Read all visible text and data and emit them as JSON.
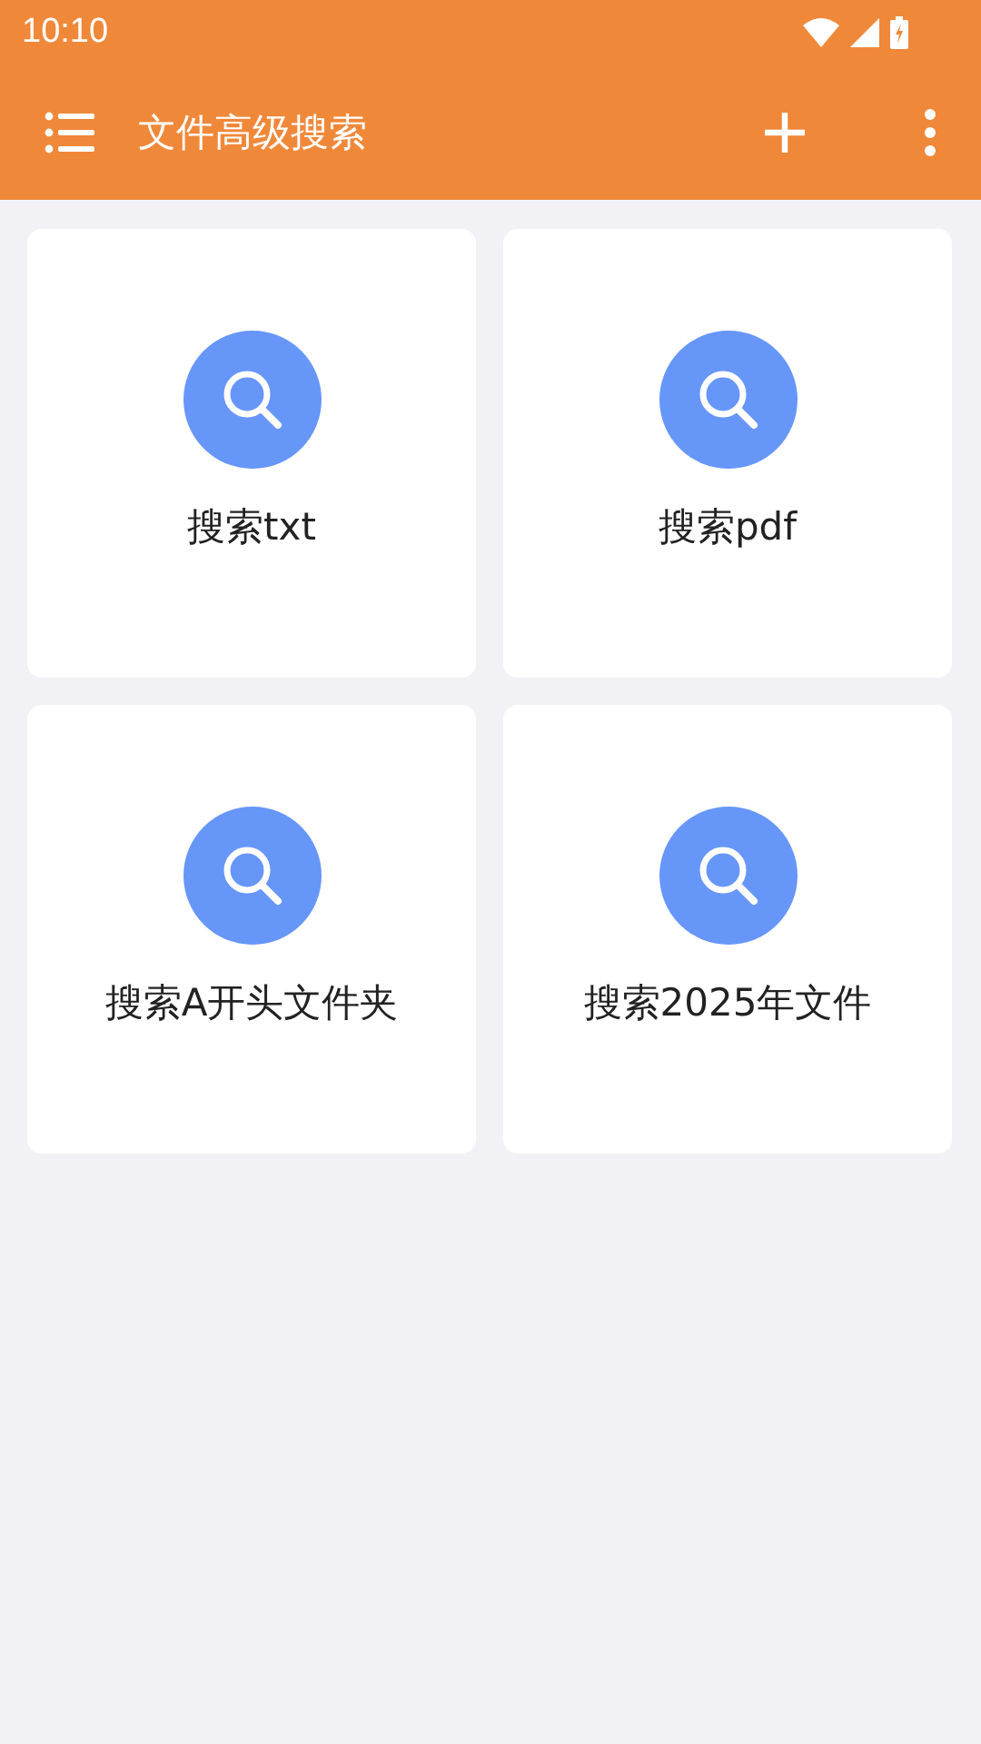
{
  "status_bar": {
    "time": "10:10"
  },
  "app_bar": {
    "title": "文件高级搜索"
  },
  "cards": [
    {
      "label": "搜索txt"
    },
    {
      "label": "搜索pdf"
    },
    {
      "label": "搜索A开头文件夹"
    },
    {
      "label": "搜索2025年文件"
    }
  ]
}
